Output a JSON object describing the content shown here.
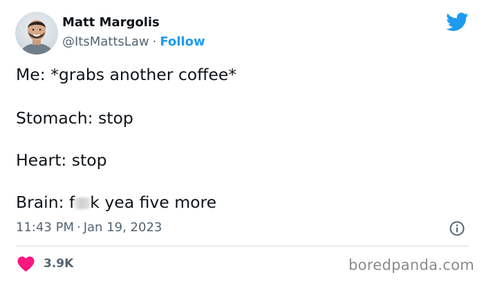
{
  "author": {
    "name": "Matt Margolis",
    "handle": "@ItsMattsLaw",
    "separator": "·",
    "follow_label": "Follow"
  },
  "tweet": {
    "line1": "Me: *grabs another coffee*",
    "line2": "Stomach: stop",
    "line3": "Heart: stop",
    "line4_prefix": "Brain: f",
    "line4_suffix": "k yea five more"
  },
  "meta": {
    "time": "11:43 PM",
    "separator": "·",
    "date": "Jan 19, 2023"
  },
  "engagement": {
    "likes": "3.9K"
  },
  "watermark": "boredpanda.com",
  "colors": {
    "accent": "#1d9bf0",
    "heart": "#f91880",
    "text": "#0f1419",
    "muted": "#536471"
  },
  "icons": [
    "avatar",
    "twitter-bird-icon",
    "info-icon",
    "heart-icon"
  ]
}
